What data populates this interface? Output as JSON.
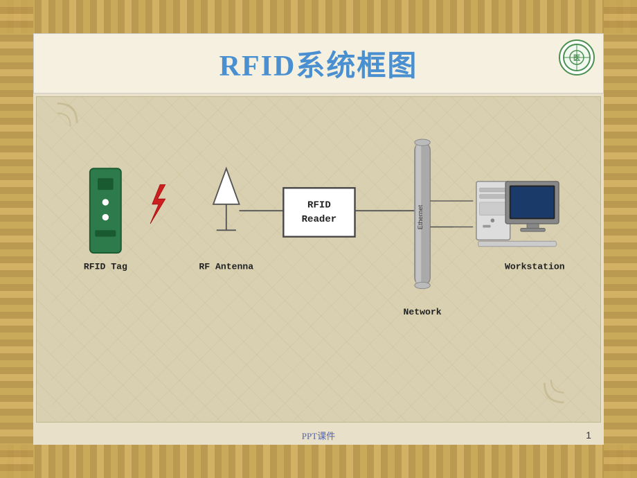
{
  "slide": {
    "title": "RFID系统框图",
    "background_color": "#c8b97a",
    "content_bg": "#e8e0c8",
    "diagram_bg": "#d8d0b0"
  },
  "components": {
    "rfid_tag": {
      "label": "RFID Tag",
      "color": "#2d7a4a"
    },
    "rf_antenna": {
      "label": "RF Antenna"
    },
    "rfid_reader": {
      "label_line1": "RFID",
      "label_line2": "Reader"
    },
    "network": {
      "label": "Network",
      "sublabel": "Ethernet"
    },
    "workstation": {
      "label": "Workstation"
    }
  },
  "footer": {
    "text": "PPT课件",
    "page": "1"
  },
  "logo": {
    "alt": "school-logo"
  }
}
